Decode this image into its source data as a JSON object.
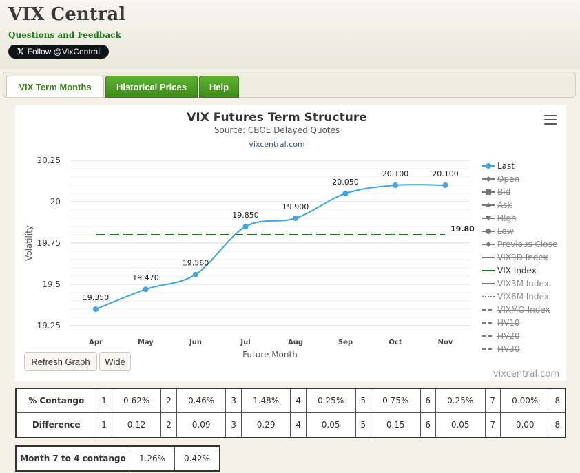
{
  "site": {
    "title": "VIX Central",
    "feedback_link": "Questions and Feedback",
    "follow_button": "Follow @VixCentral"
  },
  "tabs": [
    {
      "label": "VIX Term Months",
      "active": true
    },
    {
      "label": "Historical Prices",
      "active": false
    },
    {
      "label": "Help",
      "active": false
    }
  ],
  "chart_data": {
    "type": "line",
    "title": "VIX Futures Term Structure",
    "subtitle": "Source: CBOE Delayed Quotes",
    "credit": "vixcentral.com",
    "xlabel": "Future Month",
    "ylabel": "Volatility",
    "categories": [
      "Apr",
      "May",
      "Jun",
      "Jul",
      "Aug",
      "Sep",
      "Oct",
      "Nov"
    ],
    "ylim": [
      19.25,
      20.25
    ],
    "yticks": [
      "19.25",
      "19.5",
      "19.75",
      "20",
      "20.25"
    ],
    "grid": true,
    "legend_position": "right",
    "series": [
      {
        "name": "Last",
        "values": [
          19.35,
          19.47,
          19.56,
          19.85,
          19.9,
          20.05,
          20.1,
          20.1
        ],
        "labels": [
          "19.350",
          "19.470",
          "19.560",
          "19.850",
          "19.900",
          "20.050",
          "20.100",
          "20.100"
        ],
        "color": "#3ea6e4"
      },
      {
        "name": "VIX Index",
        "value": 19.8,
        "label": "19.80",
        "color": "#1a7a1a",
        "style": "dashed"
      }
    ],
    "legend": [
      {
        "name": "Last",
        "visible": true,
        "symbol": "circle",
        "color": "#3ea6e4"
      },
      {
        "name": "Open",
        "visible": false,
        "symbol": "diamond"
      },
      {
        "name": "Bid",
        "visible": false,
        "symbol": "square"
      },
      {
        "name": "Ask",
        "visible": false,
        "symbol": "triangle"
      },
      {
        "name": "High",
        "visible": false,
        "symbol": "triangle-down"
      },
      {
        "name": "Low",
        "visible": false,
        "symbol": "circle"
      },
      {
        "name": "Previous Close",
        "visible": false,
        "symbol": "diamond"
      },
      {
        "name": "VIX9D Index",
        "visible": false,
        "symbol": "line"
      },
      {
        "name": "VIX Index",
        "visible": true,
        "symbol": "line",
        "color": "#1a7a1a"
      },
      {
        "name": "VIX3M Index",
        "visible": false,
        "symbol": "line"
      },
      {
        "name": "VIX6M Index",
        "visible": false,
        "symbol": "dotted"
      },
      {
        "name": "VIXMO Index",
        "visible": false,
        "symbol": "dashed"
      },
      {
        "name": "HV10",
        "visible": false,
        "symbol": "dashed"
      },
      {
        "name": "HV20",
        "visible": false,
        "symbol": "dashed"
      },
      {
        "name": "HV30",
        "visible": false,
        "symbol": "dashed"
      }
    ]
  },
  "controls": {
    "refresh_label": "Refresh Graph",
    "wide_label": "Wide",
    "watermark": "vixcentral.com"
  },
  "contango_table": {
    "rows": [
      {
        "header": "% Contango",
        "cells": [
          "1",
          "0.62%",
          "2",
          "0.46%",
          "3",
          "1.48%",
          "4",
          "0.25%",
          "5",
          "0.75%",
          "6",
          "0.25%",
          "7",
          "0.00%",
          "8"
        ]
      },
      {
        "header": "Difference",
        "cells": [
          "1",
          "0.12",
          "2",
          "0.09",
          "3",
          "0.29",
          "4",
          "0.05",
          "5",
          "0.15",
          "6",
          "0.05",
          "7",
          "0.00",
          "8"
        ]
      }
    ]
  },
  "month_table": {
    "header": "Month 7 to 4 contango",
    "values": [
      "1.26%",
      "0.42%"
    ]
  }
}
